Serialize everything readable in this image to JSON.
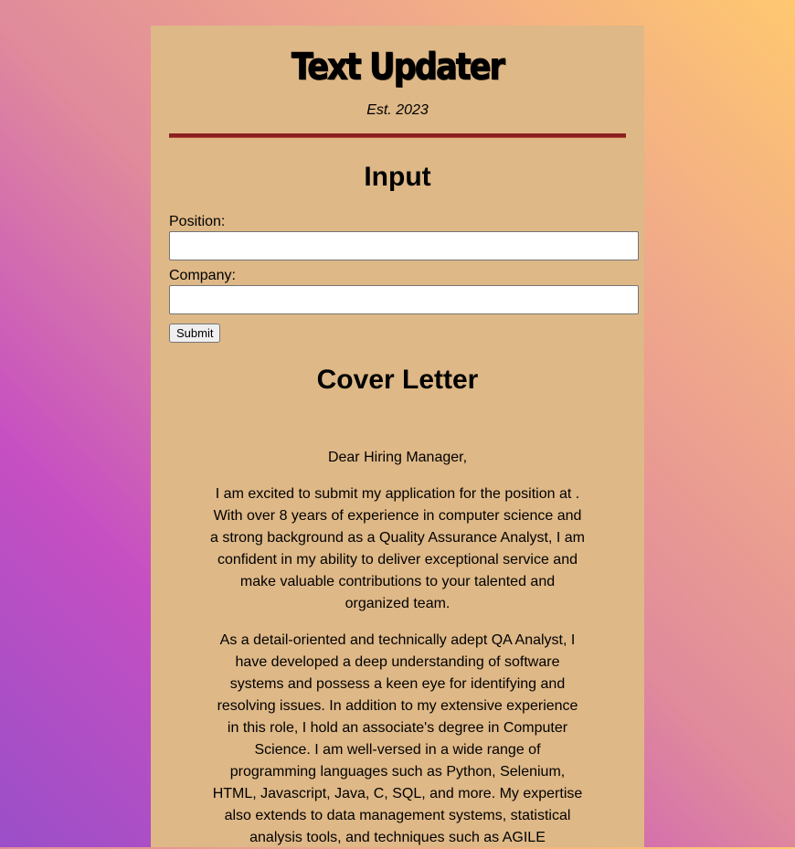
{
  "header": {
    "title": "Text Updater",
    "established": "Est. 2023"
  },
  "input_section": {
    "heading": "Input",
    "position_label": "Position:",
    "position_value": "",
    "company_label": "Company:",
    "company_value": "",
    "submit_label": "Submit"
  },
  "cover_letter": {
    "heading": "Cover Letter",
    "greeting": "Dear Hiring Manager,",
    "paragraph_1": "I am excited to submit my application for the position at . With over 8 years of experience in computer science and a strong background as a Quality Assurance Analyst, I am confident in my ability to deliver exceptional service and make valuable contributions to your talented and organized team.",
    "paragraph_2": "As a detail-oriented and technically adept QA Analyst, I have developed a deep understanding of software systems and possess a keen eye for identifying and resolving issues. In addition to my extensive experience in this role, I hold an associate's degree in Computer Science. I am well-versed in a wide range of programming languages such as Python, Selenium, HTML, Javascript, Java, C, SQL, and more. My expertise also extends to data management systems, statistical analysis tools, and techniques such as AGILE"
  },
  "colors": {
    "card_background": "#deb887",
    "divider": "#8b2020",
    "gradient_start": "#9a4fc8",
    "gradient_end": "#ffc870"
  }
}
